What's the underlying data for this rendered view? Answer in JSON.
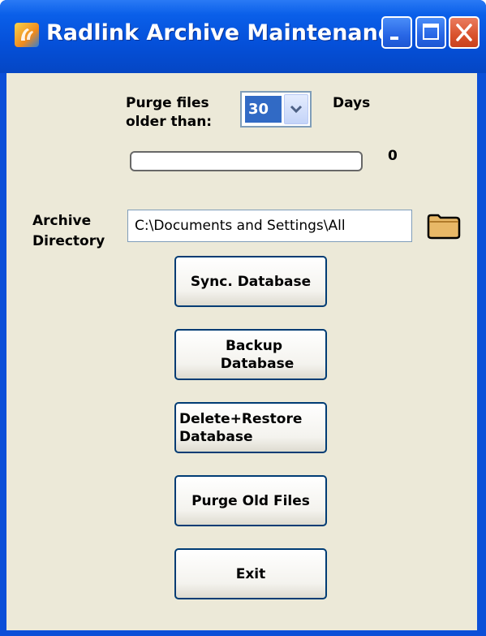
{
  "window": {
    "title": "Radlink Archive Maintenance",
    "icon": "radlink-app-icon",
    "controls": [
      "minimize-icon",
      "maximize-icon",
      "close-icon"
    ]
  },
  "purge": {
    "label_line1": "Purge files",
    "label_line2": "older than:",
    "days_value": "30",
    "days_unit": "Days"
  },
  "progress": {
    "value": 0,
    "count_label": "0"
  },
  "archive": {
    "label_line1": "Archive",
    "label_line2": "Directory",
    "path": "C:\\Documents and Settings\\All",
    "browse_icon": "folder-icon"
  },
  "buttons": {
    "sync": "Sync. Database",
    "backup_line1": "Backup",
    "backup_line2": "Database",
    "delete_line1": "Delete+Restore",
    "delete_line2": "Database",
    "purge": "Purge Old Files",
    "exit": "Exit"
  },
  "colors": {
    "titlebar": "#0550d9",
    "client_bg": "#ece9d8",
    "close_button": "#d9522c",
    "selection": "#316ac5"
  }
}
